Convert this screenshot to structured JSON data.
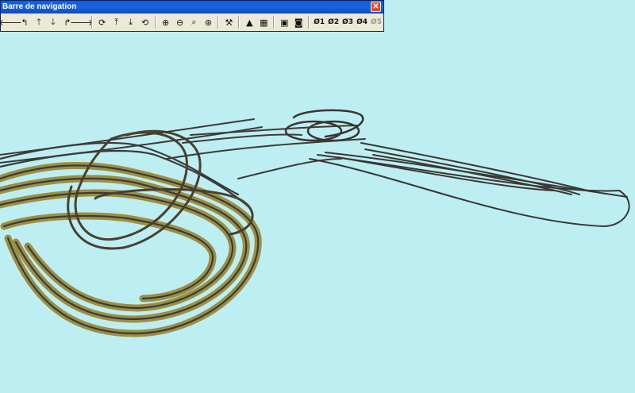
{
  "window": {
    "title": "Barre de navigation",
    "close_glyph": "✕"
  },
  "toolbar": {
    "groups": [
      [
        {
          "icon": "arrow-left-icon",
          "glyph": "🡐"
        },
        {
          "icon": "turn-left-icon",
          "glyph": "↰"
        },
        {
          "icon": "arrow-up-icon",
          "glyph": "🡑"
        },
        {
          "icon": "arrow-down-icon",
          "glyph": "🡓"
        },
        {
          "icon": "turn-right-icon",
          "glyph": "↱"
        },
        {
          "icon": "arrow-right-icon",
          "glyph": "🡒"
        }
      ],
      [
        {
          "icon": "orbit-icon",
          "glyph": "⟳"
        },
        {
          "icon": "tilt-up-icon",
          "glyph": "⤒"
        },
        {
          "icon": "tilt-down-icon",
          "glyph": "⤓"
        },
        {
          "icon": "orbit-alt-icon",
          "glyph": "⟲"
        }
      ],
      [
        {
          "icon": "zoom-in-icon",
          "glyph": "⊕"
        },
        {
          "icon": "zoom-out-icon",
          "glyph": "⊖"
        },
        {
          "icon": "zoom-area-icon",
          "glyph": "⌕"
        },
        {
          "icon": "zoom-all-icon",
          "glyph": "⊛"
        }
      ],
      [
        {
          "icon": "track-tool-icon",
          "glyph": "⚒"
        }
      ],
      [
        {
          "icon": "terrain-icon",
          "glyph": "▲"
        },
        {
          "icon": "grid-terrain-icon",
          "glyph": "▦"
        }
      ],
      [
        {
          "icon": "fit-view-icon",
          "glyph": "▣"
        },
        {
          "icon": "camera-icon",
          "glyph": "◙"
        }
      ]
    ],
    "cameras": [
      {
        "label": "1",
        "enabled": true
      },
      {
        "label": "2",
        "enabled": true
      },
      {
        "label": "3",
        "enabled": true
      },
      {
        "label": "4",
        "enabled": true
      },
      {
        "label": "5",
        "enabled": false
      }
    ],
    "camera_prefix": "Ø"
  },
  "colors": {
    "background": "#bdeef2",
    "ballast": "#9a8a3a",
    "rail": "#3b3b3b",
    "tie": "#6b4a2a"
  }
}
